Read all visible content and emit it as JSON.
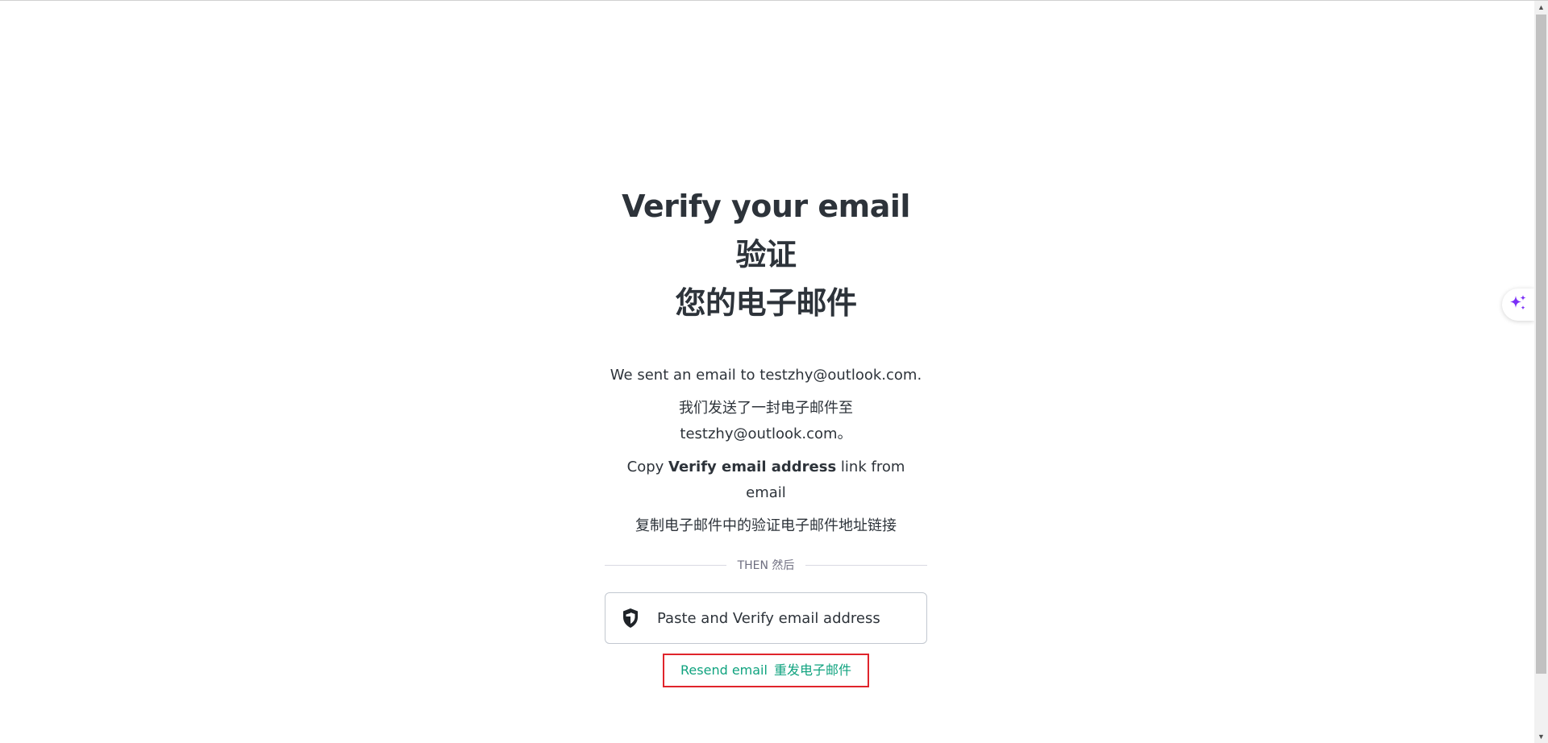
{
  "page": {
    "title_line1": "Verify your email 验证",
    "title_line2": "您的电子邮件",
    "sent_en": "We sent an email to testzhy@outlook.com.",
    "sent_zh": "我们发送了一封电子邮件至testzhy@outlook.com。",
    "copy_prefix": "Copy ",
    "copy_bold": "Verify email address",
    "copy_suffix": " link from email",
    "copy_zh": "复制电子邮件中的验证电子邮件地址链接",
    "divider_label": "THEN 然后",
    "paste_button_label": "Paste and Verify email address",
    "resend_label_en": "Resend email",
    "resend_label_zh": "重发电子邮件"
  },
  "colors": {
    "text": "#2d333a",
    "link": "#10a37f",
    "highlight_border": "#e0242c",
    "ai_icon": "#7b2ff7"
  },
  "icons": {
    "paste_button": "shield-icon",
    "assistant": "sparkle-icon"
  }
}
